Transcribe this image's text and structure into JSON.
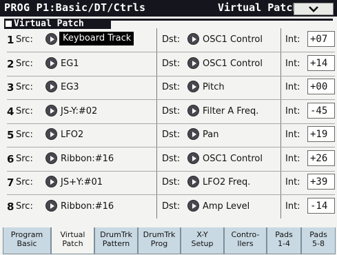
{
  "header": {
    "title": "PROG P1:Basic/DT/Ctrls",
    "subtitle": "Virtual Patch"
  },
  "section": {
    "title": "Virtual Patch"
  },
  "labels": {
    "src": "Src:",
    "dst": "Dst:",
    "int": "Int:"
  },
  "patches": [
    {
      "num": "1",
      "src": "Keyboard Track",
      "dst": "OSC1 Control",
      "int": "+07",
      "selected": true
    },
    {
      "num": "2",
      "src": "EG1",
      "dst": "OSC1 Control",
      "int": "+14"
    },
    {
      "num": "3",
      "src": "EG3",
      "dst": "Pitch",
      "int": "+00"
    },
    {
      "num": "4",
      "src": "JS-Y:#02",
      "dst": "Filter A Freq.",
      "int": "-45"
    },
    {
      "num": "5",
      "src": "LFO2",
      "dst": "Pan",
      "int": "+19"
    },
    {
      "num": "6",
      "src": "Ribbon:#16",
      "dst": "OSC1 Control",
      "int": "+26"
    },
    {
      "num": "7",
      "src": "JS+Y:#01",
      "dst": "LFO2 Freq.",
      "int": "+39"
    },
    {
      "num": "8",
      "src": "Ribbon:#16",
      "dst": "Amp Level",
      "int": "-14"
    }
  ],
  "tabs": [
    {
      "line1": "Program",
      "line2": "Basic"
    },
    {
      "line1": "Virtual",
      "line2": "Patch",
      "active": true
    },
    {
      "line1": "DrumTrk",
      "line2": "Pattern"
    },
    {
      "line1": "DrumTrk",
      "line2": "Prog"
    },
    {
      "line1": "X-Y",
      "line2": "Setup"
    },
    {
      "line1": "Contro-",
      "line2": "llers"
    },
    {
      "line1": "Pads",
      "line2": "1-4"
    },
    {
      "line1": "Pads",
      "line2": "5-8"
    }
  ],
  "icons": {
    "menu": "chevron-down-icon",
    "row_arrow": "arrow-right-icon"
  }
}
